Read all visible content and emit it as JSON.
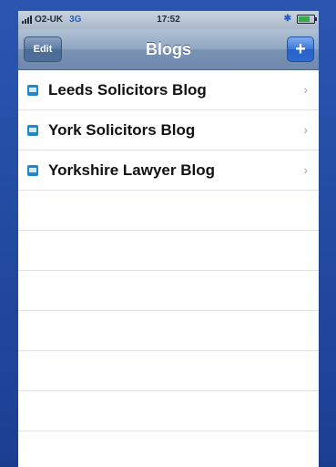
{
  "status_bar": {
    "carrier": "O2-UK",
    "network": "3G",
    "time": "17:52"
  },
  "nav": {
    "title": "Blogs",
    "edit_label": "Edit",
    "add_label": "+"
  },
  "blogs": [
    {
      "label": "Leeds Solicitors Blog",
      "chevron": "›"
    },
    {
      "label": "York Solicitors Blog",
      "chevron": "›"
    },
    {
      "label": "Yorkshire Lawyer Blog",
      "chevron": "›"
    }
  ],
  "colors": {
    "frame": "#1c3f93",
    "nav_bar": "#8fa6c2",
    "add_button": "#2c6ad0",
    "row_icon": "#1e88c9"
  },
  "icons": {
    "blog_row": "blog-icon",
    "battery": "battery-icon",
    "bluetooth": "bluetooth-icon"
  }
}
